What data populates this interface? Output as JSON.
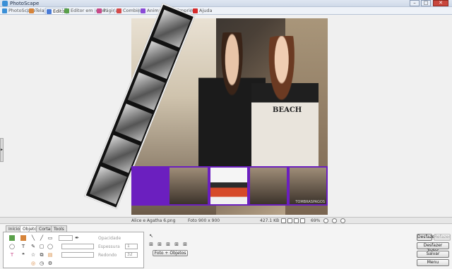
{
  "window": {
    "title": "PhotoScape",
    "controls": {
      "minimize": "–",
      "maximize": "□",
      "close": "✕"
    }
  },
  "tabs": [
    {
      "label": "PhotoScape",
      "icon": "photoscape-icon",
      "active": false
    },
    {
      "label": "Tela",
      "icon": "viewer-icon",
      "active": false
    },
    {
      "label": "Editor",
      "icon": "editor-icon",
      "active": true
    },
    {
      "label": "Editor em lotes",
      "icon": "batch-editor-icon",
      "active": false
    },
    {
      "label": "Página",
      "icon": "page-icon",
      "active": false
    },
    {
      "label": "Combine",
      "icon": "combine-icon",
      "active": false
    },
    {
      "label": "Animação GIF",
      "icon": "gif-icon",
      "active": false
    },
    {
      "label": "Imprimir",
      "icon": "print-icon",
      "active": false
    },
    {
      "label": "Ajuda",
      "icon": "help-icon",
      "active": false
    }
  ],
  "canvas": {
    "shirt_text": "BEACH",
    "credit": "TOMBRASPAGOS"
  },
  "status": {
    "filename": "Alice e Agatha 6.png",
    "dimensions": "Foto 900 x 900",
    "filesize": "427.1 KB",
    "zoom": "69%"
  },
  "bottom_tabs": [
    "Início",
    "Objeto",
    "Cortar",
    "Tools"
  ],
  "active_bottom_tab": "Objeto",
  "object_panel": {
    "opacity_label": "Opacidade",
    "thickness_label": "Espessura",
    "thickness_value": "1",
    "rounding_label": "Redondo",
    "rounding_value": "32",
    "photo_objects_button": "Foto + Objetos"
  },
  "actions": {
    "undo": "Desfazer",
    "redo": "Refazer",
    "undo_all": "Desfazer Todos",
    "save": "Salvar",
    "menu": "Menu"
  },
  "colors": {
    "strip_border": "#6b1fbf",
    "tab_active": "#ffffff",
    "close_button": "#c9473d"
  }
}
